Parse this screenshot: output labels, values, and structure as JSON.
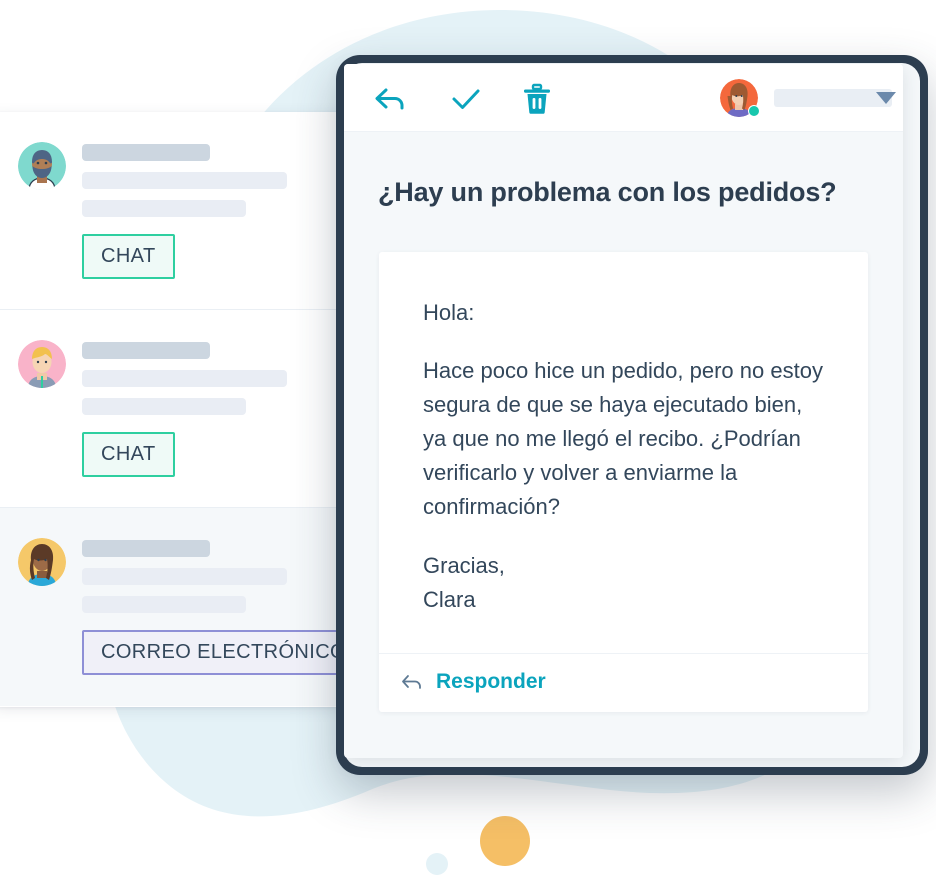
{
  "palette": {
    "teal_accent": "#0ba4bd",
    "navy_text": "#2d3e50",
    "body_text": "#33475b",
    "chat_badge_border": "#2ecfa0",
    "chat_badge_bg": "#effaf7",
    "email_badge_border": "#8e8fd6",
    "email_badge_bg": "#f0f0f8",
    "blob_blue": "#e4f2f7",
    "accent_orange": "#f5bf66",
    "device_frame": "#2d3e50",
    "status_dot_green": "#18c7ad",
    "skeleton_dark": "#ccd6e0",
    "skeleton_light": "#e9edf4"
  },
  "conversation_list": {
    "rows": [
      {
        "avatar_bg": "#7fd9ce",
        "avatar_name": "avatar-bearded-man",
        "badge_label": "CHAT",
        "badge_type": "chat",
        "selected": false
      },
      {
        "avatar_bg": "#f9b3c9",
        "avatar_name": "avatar-blonde-person",
        "badge_label": "CHAT",
        "badge_type": "chat",
        "selected": false
      },
      {
        "avatar_bg": "#f5c869",
        "avatar_name": "avatar-curly-hair-woman",
        "badge_label": "CORREO ELECTRÓNICO",
        "badge_type": "email",
        "selected": true
      }
    ]
  },
  "mail": {
    "toolbar": {
      "reply_icon": "reply-arrow-icon",
      "approve_icon": "check-icon",
      "delete_icon": "trash-icon",
      "avatar_icon": "user-avatar",
      "status": "online",
      "account_placeholder": "",
      "dropdown_icon": "chevron-down-icon"
    },
    "subject": "¿Hay un problema con los pedidos?",
    "body": {
      "greeting": "Hola:",
      "paragraph": "Hace poco hice un pedido, pero no estoy segura de que se haya ejecutado bien, ya que no me llegó el recibo. ¿Podrían verificarlo y volver a enviarme la confirmación?",
      "sign_off": "Gracias,",
      "sender": "Clara"
    },
    "footer": {
      "reply_icon": "reply-arrow-icon",
      "reply_label": "Responder"
    }
  }
}
